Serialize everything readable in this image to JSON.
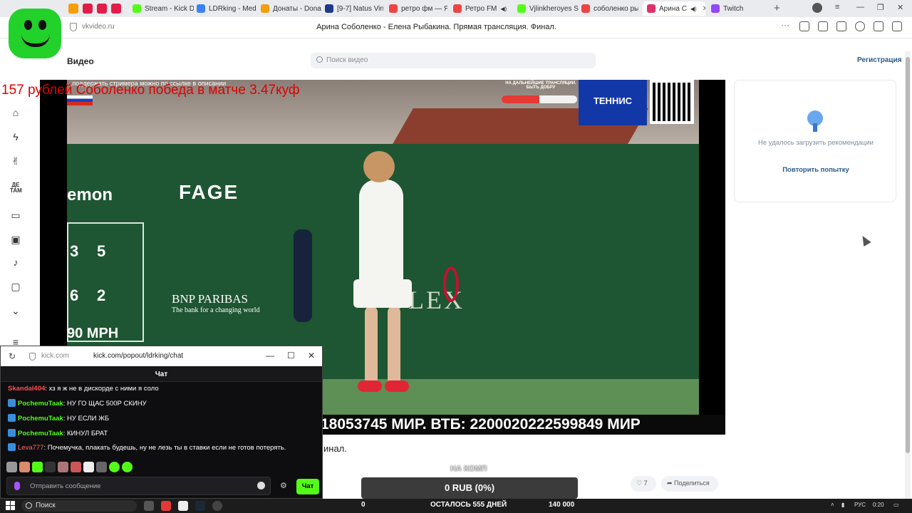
{
  "browser": {
    "tabs": [
      {
        "label": "Stream - Kick D",
        "color": "#53fc18"
      },
      {
        "label": "LDRking - Med",
        "color": "#3b82f6"
      },
      {
        "label": "Донаты - Dona",
        "color": "#f59e0b"
      },
      {
        "label": "[9-7] Natus Vin",
        "color": "#1e3a8a"
      },
      {
        "label": "ретро фм — Я",
        "color": "#ef4444"
      },
      {
        "label": "Ретро FM",
        "color": "#ef4444"
      },
      {
        "label": "Vjlinkheroyes S",
        "color": "#53fc18"
      },
      {
        "label": "соболенко ры",
        "color": "#ef4444"
      },
      {
        "label": "Арина С",
        "color": "#e1306c"
      },
      {
        "label": "Twitch",
        "color": "#9146ff"
      }
    ],
    "new_tab": "+",
    "url_host": "vkvideo.ru",
    "page_title": "Арина Соболенко - Елена Рыбакина. Прямая трансляция. Финал."
  },
  "site": {
    "name": "Видео",
    "search_placeholder": "Поиск видео",
    "register": "Регистрация"
  },
  "leftnav": [
    "home-icon",
    "lightning-icon",
    "peace-icon",
    "kids-icon",
    "book-icon",
    "clip-icon",
    "music-icon",
    "tv-icon",
    "chevron-down-icon",
    "menu-icon"
  ],
  "leftnav_kids_label": "ДЕ ТАМ",
  "video": {
    "top_text": "...поддержать стримера можно по ссылке в описании",
    "donate_text": "НА ДАЛЬНЕЙШИЕ ТРАНСЛЯЦИИ. БЫТЬ ДОБРУ",
    "donate_progress": 0.5,
    "tennis_label": "ТЕННИС",
    "ad_lemon": "emon",
    "ad_fage": "FAGE",
    "ad_bnp": "BNP PARIBAS",
    "ad_bnp_sub": "The bank for a changing world",
    "ad_rolex": "OLEX",
    "score_row1": [
      "3",
      "5"
    ],
    "score_row2": [
      "6",
      "2"
    ],
    "mph": "90 MPH",
    "ticker": "18053745 МИР. ВТБ: 2200020222599849 МИР"
  },
  "overlay_red": "157 рублей Соболенко победа в матче 3.47куф",
  "recommendations": {
    "message": "Не удалось загрузить рекомендации",
    "retry": "Повторить попытку"
  },
  "under_video_title": "инал.",
  "actions": {
    "likes": "7",
    "share": "Поделиться"
  },
  "donation_widget": {
    "label": "НА КОМП",
    "amount": "0 RUB (0%)",
    "progress": 0
  },
  "popup": {
    "host": "kick.com",
    "url": "kick.com/popout/ldrking/chat",
    "chat_title": "Чат",
    "messages": [
      {
        "user": "Skandal404",
        "text": "хз я ж не в дискорде с ними я соло"
      },
      {
        "user": "PochemuTaak",
        "text": "НУ ГО ЩАС 500Р СКИНУ"
      },
      {
        "user": "PochemuTaak",
        "text": "НУ ЕСЛИ ЖБ"
      },
      {
        "user": "PochemuTaak",
        "text": "КИНУЛ БРАТ"
      },
      {
        "user": "Leva777",
        "text": "Почемучка, плакать будешь, ну не лезь ты в ставки если не готов потерять."
      }
    ],
    "input_placeholder": "Отправить сообщение",
    "send_label": "Чат"
  },
  "taskbar": {
    "search_label": "Поиск",
    "stat_left": "0",
    "stat_mid": "ОСТАЛОСЬ 555 ДНЕЙ",
    "stat_right": "140 000",
    "lang": "РУС",
    "time": "0:20"
  },
  "colors": {
    "vk_link": "#2a5885",
    "kick_green": "#53fc18"
  }
}
